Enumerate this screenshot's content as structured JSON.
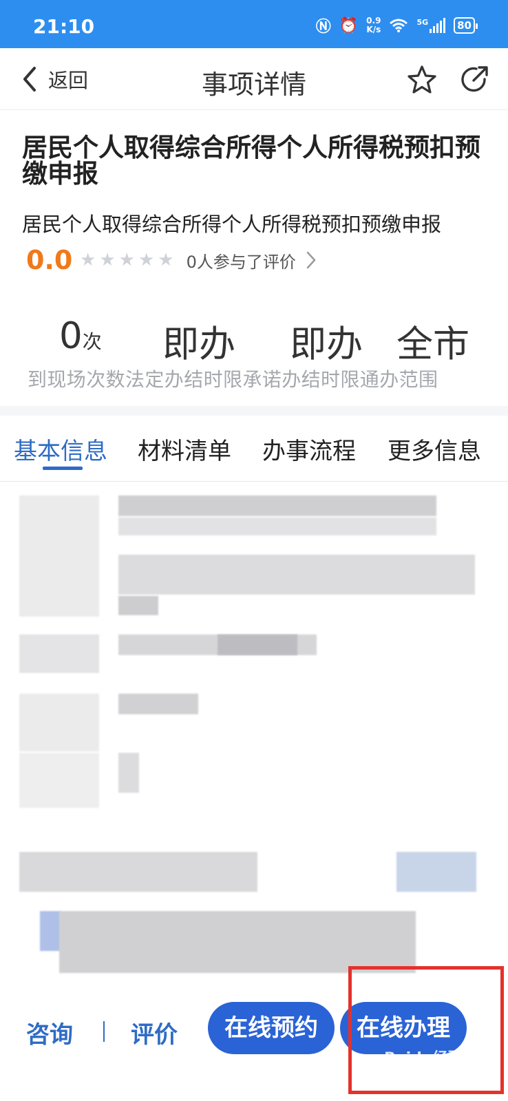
{
  "status_bar": {
    "time": "21:10",
    "speed_value": "0.9",
    "speed_unit": "K/s",
    "network_label": "5G",
    "battery": "80"
  },
  "nav": {
    "back_label": "返回",
    "title": "事项详情"
  },
  "item": {
    "title": "居民个人取得综合所得个人所得税预扣预缴申报",
    "subtitle": "居民个人取得综合所得个人所得税预扣预缴申报",
    "score": "0.0",
    "stars_filled": 0,
    "stars_total": 5,
    "rating_text": "0人参与了评价"
  },
  "stats": {
    "visits_value": "0",
    "visits_unit": "次",
    "legal_limit": "即办",
    "promised_limit": "即办",
    "scope": "全市",
    "labels": "到现场次数法定办结时限承诺办结时限通办范围"
  },
  "tabs": [
    {
      "label": "基本信息",
      "active": true
    },
    {
      "label": "材料清单",
      "active": false
    },
    {
      "label": "办事流程",
      "active": false
    },
    {
      "label": "更多信息",
      "active": false
    }
  ],
  "bottom_bar": {
    "consult_label": "咨询",
    "review_label": "评价",
    "appointment_label": "在线预约",
    "handle_label": "在线办理"
  },
  "watermark": {
    "text": "Baidu经验",
    "url": "jingyan.baidu.com"
  },
  "colors": {
    "status_bar": "#2d8ef0",
    "accent_blue": "#2e6cc5",
    "button_blue": "#2a63d6",
    "score_orange": "#ef7a1a",
    "highlight_red": "#e5312b"
  }
}
